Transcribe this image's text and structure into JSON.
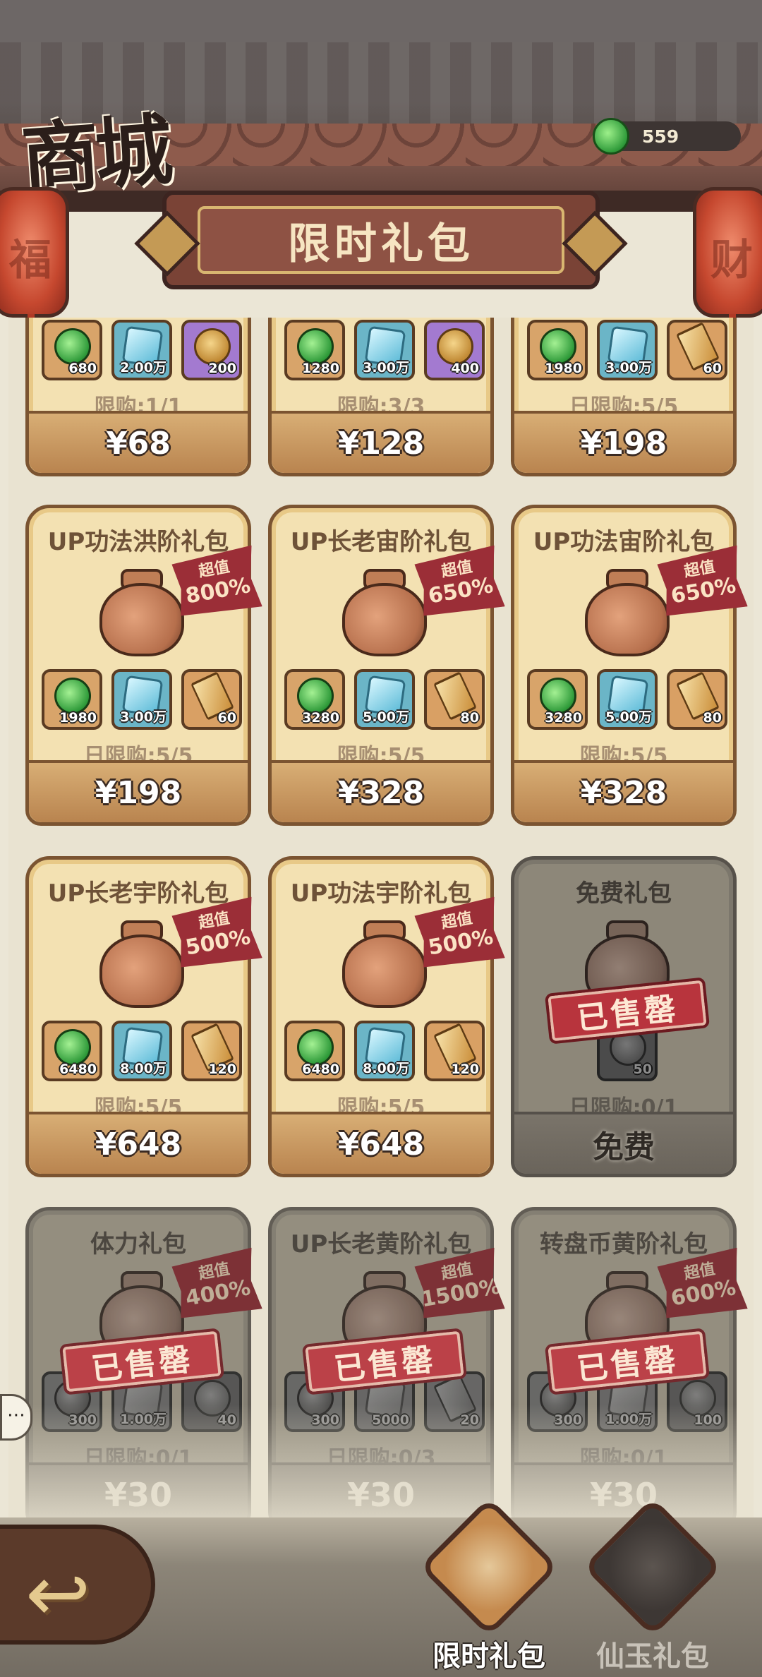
{
  "header": {
    "title": "商城",
    "currency_value": "559",
    "section_banner": "限时礼包",
    "lantern_left": "福",
    "lantern_right": "财"
  },
  "row0": [
    {
      "items": [
        {
          "type": "gem",
          "qty": "680"
        },
        {
          "type": "jade",
          "qty": "2.00万"
        },
        {
          "type": "coin",
          "qty": "200"
        }
      ],
      "limit": "限购:1/1",
      "price": "¥68"
    },
    {
      "items": [
        {
          "type": "gem",
          "qty": "1280"
        },
        {
          "type": "jade",
          "qty": "3.00万"
        },
        {
          "type": "coin",
          "qty": "400"
        }
      ],
      "limit": "限购:3/3",
      "price": "¥128"
    },
    {
      "items": [
        {
          "type": "gem",
          "qty": "1980"
        },
        {
          "type": "jade",
          "qty": "3.00万"
        },
        {
          "type": "key",
          "qty": "60"
        }
      ],
      "limit": "日限购:5/5",
      "price": "¥198"
    }
  ],
  "row1": [
    {
      "name": "UP功法洪阶礼包",
      "badge_top": "超值",
      "badge_pct": "800%",
      "items": [
        {
          "type": "gem",
          "qty": "1980"
        },
        {
          "type": "jade",
          "qty": "3.00万"
        },
        {
          "type": "key",
          "qty": "60"
        }
      ],
      "limit": "日限购:5/5",
      "price": "¥198"
    },
    {
      "name": "UP长老宙阶礼包",
      "badge_top": "超值",
      "badge_pct": "650%",
      "items": [
        {
          "type": "gem",
          "qty": "3280"
        },
        {
          "type": "jade",
          "qty": "5.00万"
        },
        {
          "type": "key",
          "qty": "80"
        }
      ],
      "limit": "限购:5/5",
      "price": "¥328"
    },
    {
      "name": "UP功法宙阶礼包",
      "badge_top": "超值",
      "badge_pct": "650%",
      "items": [
        {
          "type": "gem",
          "qty": "3280"
        },
        {
          "type": "jade",
          "qty": "5.00万"
        },
        {
          "type": "key",
          "qty": "80"
        }
      ],
      "limit": "限购:5/5",
      "price": "¥328"
    }
  ],
  "row2": [
    {
      "name": "UP长老宇阶礼包",
      "badge_top": "超值",
      "badge_pct": "500%",
      "items": [
        {
          "type": "gem",
          "qty": "6480"
        },
        {
          "type": "jade",
          "qty": "8.00万"
        },
        {
          "type": "key",
          "qty": "120"
        }
      ],
      "limit": "限购:5/5",
      "price": "¥648"
    },
    {
      "name": "UP功法宇阶礼包",
      "badge_top": "超值",
      "badge_pct": "500%",
      "items": [
        {
          "type": "gem",
          "qty": "6480"
        },
        {
          "type": "jade",
          "qty": "8.00万"
        },
        {
          "type": "key",
          "qty": "120"
        }
      ],
      "limit": "限购:5/5",
      "price": "¥648"
    },
    {
      "name": "免费礼包",
      "sold": "已售罄",
      "item_qty": "50",
      "limit": "日限购:0/1",
      "price": "免费"
    }
  ],
  "row3": [
    {
      "name": "体力礼包",
      "badge_top": "超值",
      "badge_pct": "400%",
      "sold": "已售罄",
      "items": [
        {
          "type": "gem",
          "qty": "300"
        },
        {
          "type": "jade",
          "qty": "1.00万"
        },
        {
          "type": "coin",
          "qty": "40"
        }
      ],
      "limit": "日限购:0/1",
      "price": "¥30"
    },
    {
      "name": "UP长老黄阶礼包",
      "badge_top": "超值",
      "badge_pct": "1500%",
      "sold": "已售罄",
      "items": [
        {
          "type": "gem",
          "qty": "300"
        },
        {
          "type": "jade",
          "qty": "5000"
        },
        {
          "type": "key",
          "qty": "20"
        }
      ],
      "limit": "日限购:0/3",
      "price": "¥30"
    },
    {
      "name": "转盘币黄阶礼包",
      "badge_top": "超值",
      "badge_pct": "600%",
      "sold": "已售罄",
      "items": [
        {
          "type": "gem",
          "qty": "300"
        },
        {
          "type": "jade",
          "qty": "1.00万"
        },
        {
          "type": "coin",
          "qty": "100"
        }
      ],
      "limit": "限购:0/1",
      "price": "¥30"
    }
  ],
  "nav": {
    "chat_glyph": "⋯",
    "back_glyph": "↩",
    "tab_active": "限时礼包",
    "tab_inactive": "仙玉礼包"
  }
}
